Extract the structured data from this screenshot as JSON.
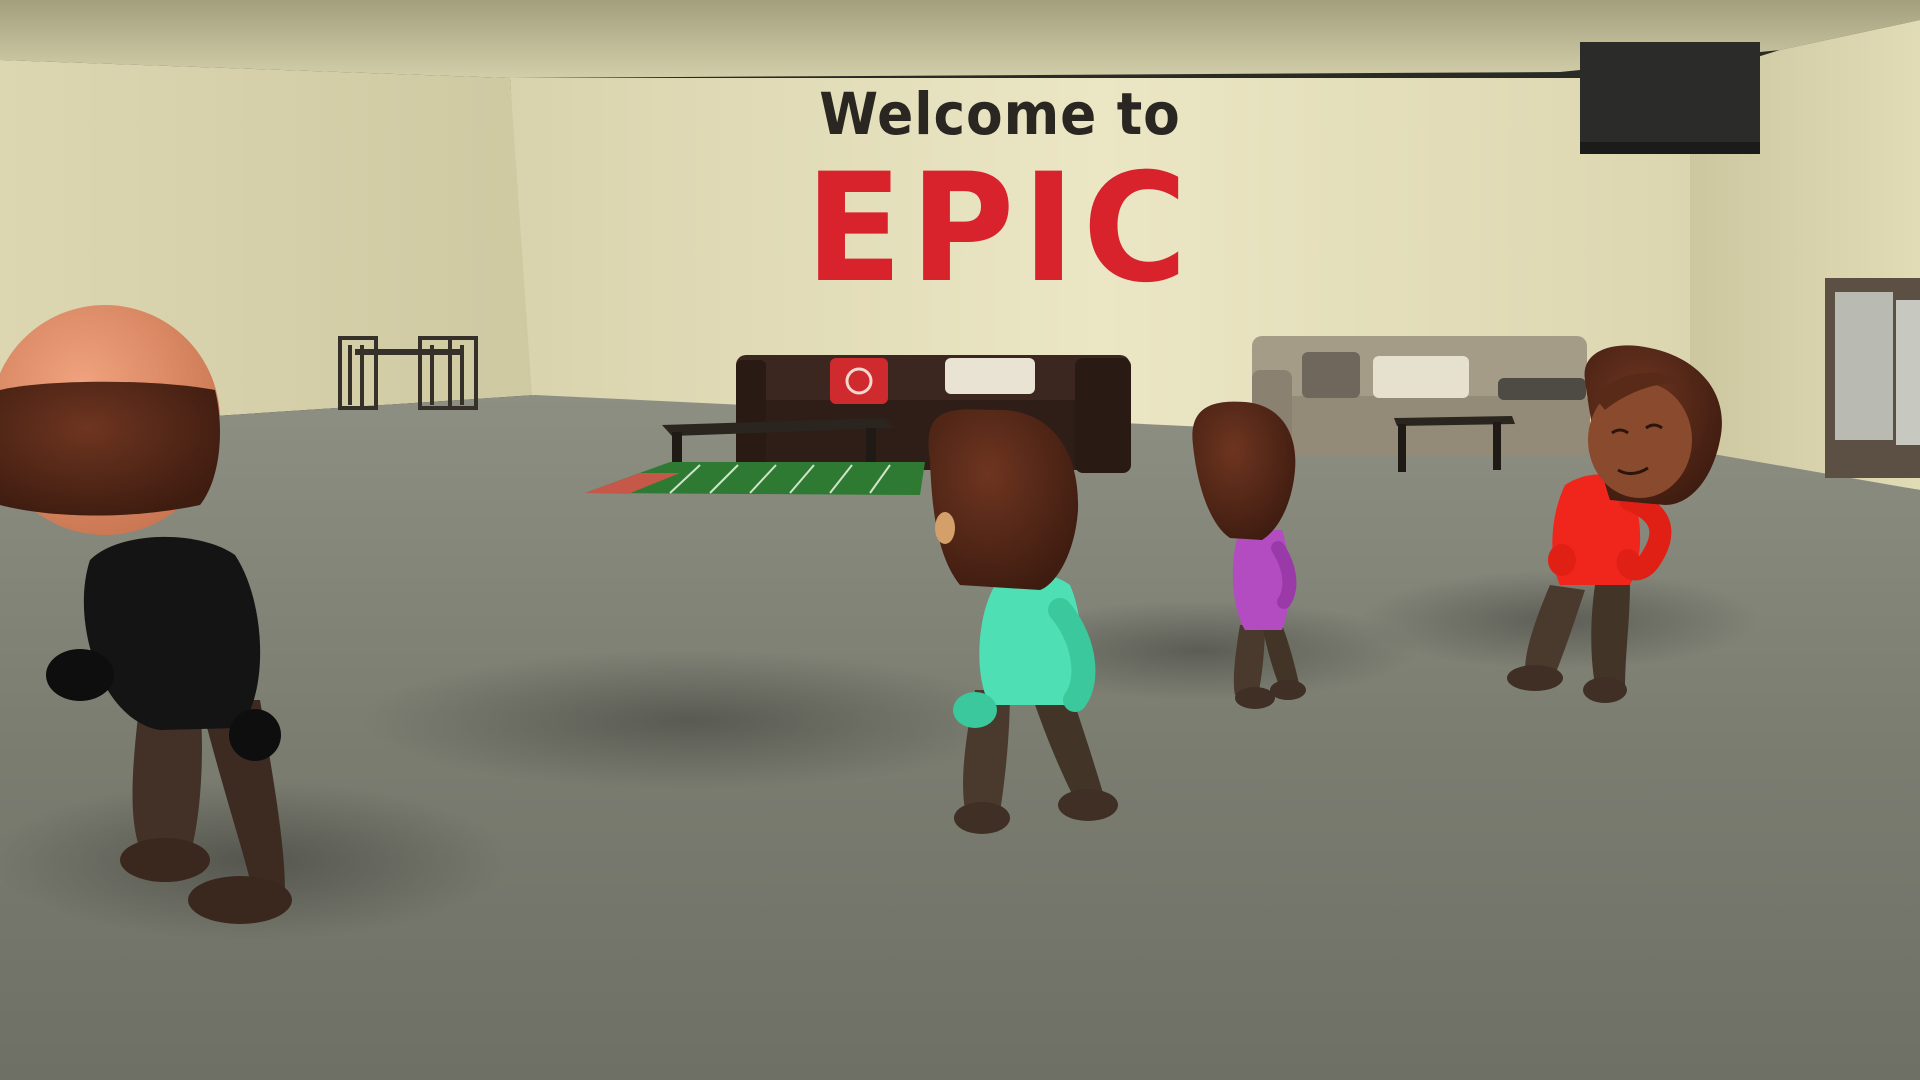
{
  "scene": {
    "sign": {
      "line1": "Welcome to",
      "line2": "EPIC"
    },
    "colors": {
      "sign_accent": "#d8222c",
      "wall": "#e8e2bf",
      "floor": "#7f8175"
    },
    "characters": [
      {
        "label": "bald-character",
        "shirt_color": "#141414"
      },
      {
        "label": "teal-shirt-character",
        "shirt_color": "#4ee0b4"
      },
      {
        "label": "purple-shirt-character",
        "shirt_color": "#b24cc0"
      },
      {
        "label": "red-shirt-character",
        "shirt_color": "#f0261c"
      }
    ]
  }
}
